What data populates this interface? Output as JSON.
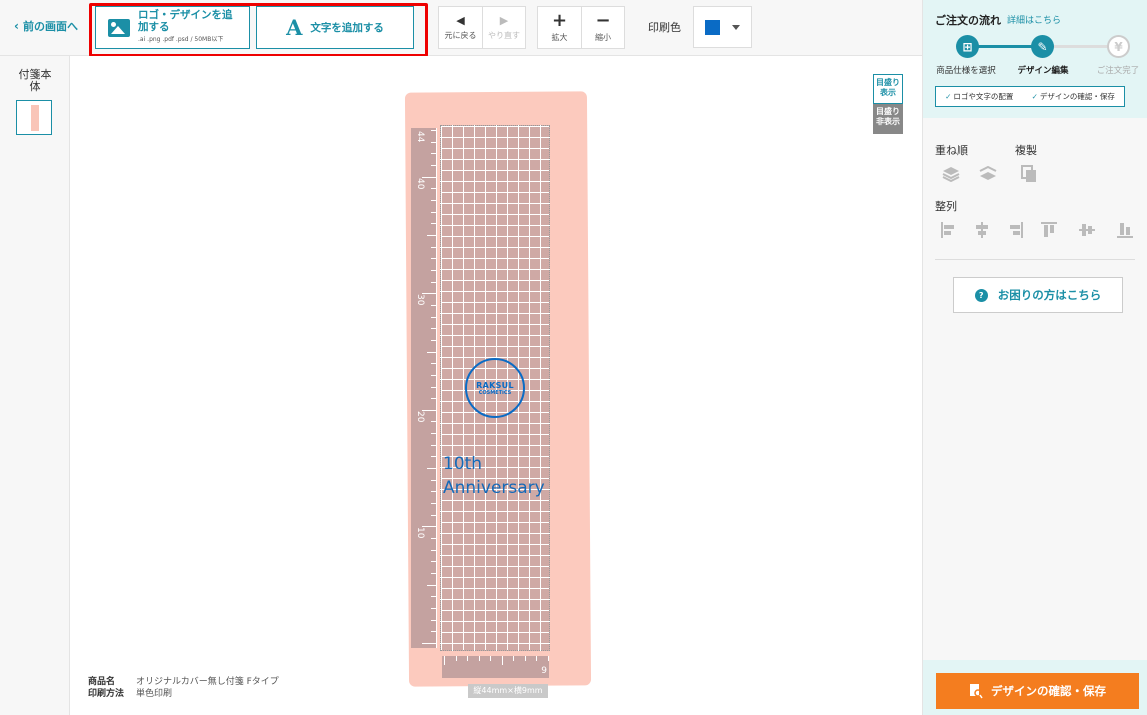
{
  "toolbar": {
    "back_label": "前の画面へ",
    "add_logo_label": "ロゴ・デザインを追加する",
    "add_logo_sub": ".ai .png .pdf .psd / 50MB以下",
    "add_text_label": "文字を追加する",
    "undo_label": "元に戻る",
    "redo_label": "やり直す",
    "zoom_in_label": "拡大",
    "zoom_out_label": "縮小",
    "print_color_label": "印刷色",
    "print_color_value": "#0a6bc5"
  },
  "left": {
    "title": "付箋本体"
  },
  "canvas": {
    "ruler_show": "目盛り表示",
    "ruler_hide": "目盛り非表示",
    "ruler_numbers": [
      "44",
      "40",
      "30",
      "20",
      "10"
    ],
    "hruler_number": "9",
    "seal_line1": "RAKSUL",
    "seal_line2": "COSMETICS",
    "text_line1": "10th",
    "text_line2": "Anniversary",
    "size_label": "縦44mm×横9mm",
    "meta": [
      {
        "key": "商品名",
        "value": "オリジナルカバー無し付箋 Fタイプ"
      },
      {
        "key": "印刷方法",
        "value": "単色印刷"
      }
    ]
  },
  "panel": {
    "flow_title": "ご注文の流れ",
    "flow_link": "詳細はこちら",
    "steps": [
      {
        "label": "商品仕様を選択",
        "icon": "gift-icon"
      },
      {
        "label": "デザイン編集",
        "icon": "pencil-icon"
      },
      {
        "label": "ご注文完了",
        "icon": "yen-icon"
      }
    ],
    "substeps": [
      "ロゴや文字の配置",
      "デザインの確認・保存"
    ],
    "order_label": "重ね順",
    "duplicate_label": "複製",
    "align_label": "整列",
    "help_label": "お困りの方はこちら",
    "confirm_label": "デザインの確認・保存"
  },
  "colors": {
    "accent": "#1b8fa6",
    "sticky": "#fccabe",
    "confirm": "#f47d1f",
    "highlight": "#e00000"
  }
}
